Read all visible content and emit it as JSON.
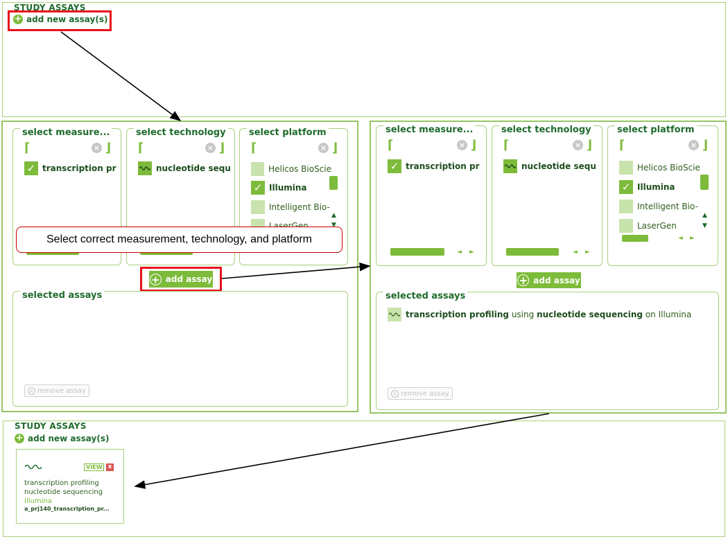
{
  "top_study": {
    "title": "STUDY ASSAYS",
    "add_label": "add new assay(s)"
  },
  "left_stage": {
    "columns": [
      {
        "title": "select measure...",
        "items": [
          {
            "label": "transcription pr",
            "state": "checked"
          }
        ]
      },
      {
        "title": "select technology",
        "items": [
          {
            "label": "nucleotide sequ",
            "state": "wave"
          }
        ]
      },
      {
        "title": "select platform",
        "items": [
          {
            "label": "Helicos BioScie",
            "state": "empty"
          },
          {
            "label": "Illumina",
            "state": "checked"
          },
          {
            "label": "Intelligent Bio-",
            "state": "empty"
          },
          {
            "label": "LaserGen",
            "state": "empty"
          }
        ]
      }
    ],
    "add_button": "add assay",
    "selected_title": "selected assays",
    "remove_label": "remove assay"
  },
  "callout": {
    "text": "Select correct measurement, technology, and platform"
  },
  "right_stage": {
    "columns": [
      {
        "title": "select measure...",
        "items": [
          {
            "label": "transcription pr",
            "state": "checked"
          }
        ]
      },
      {
        "title": "select technology",
        "items": [
          {
            "label": "nucleotide sequ",
            "state": "wave"
          }
        ]
      },
      {
        "title": "select platform",
        "items": [
          {
            "label": "Helicos BioScie",
            "state": "empty"
          },
          {
            "label": "Illumina",
            "state": "checked"
          },
          {
            "label": "Intelligent Bio-",
            "state": "empty"
          },
          {
            "label": "LaserGen",
            "state": "empty"
          }
        ]
      }
    ],
    "add_button": "add assay",
    "selected_title": "selected assays",
    "selected_assay": {
      "measurement": "transcription profiling",
      "using": "using",
      "technology": "nucleotide sequencing",
      "on": "on",
      "platform": "Illumina"
    },
    "remove_label": "remove assay"
  },
  "bottom_study": {
    "title": "STUDY ASSAYS",
    "add_label": "add new assay(s)",
    "card": {
      "view_label": "VIEW",
      "delete_label": "x",
      "measurement": "transcription profiling",
      "technology": "nucleotide sequencing",
      "platform": "Illumina",
      "file": "a_prj140_transcription_pr..."
    }
  },
  "colors": {
    "accent": "#7dbb3a",
    "title": "#1e6b2c",
    "highlight": "#e8101b",
    "border": "#a9cf7d"
  },
  "icons": {
    "plus": "plus-circle-icon",
    "check": "check-icon",
    "wave": "wave-icon",
    "clear": "clear-x-icon"
  }
}
